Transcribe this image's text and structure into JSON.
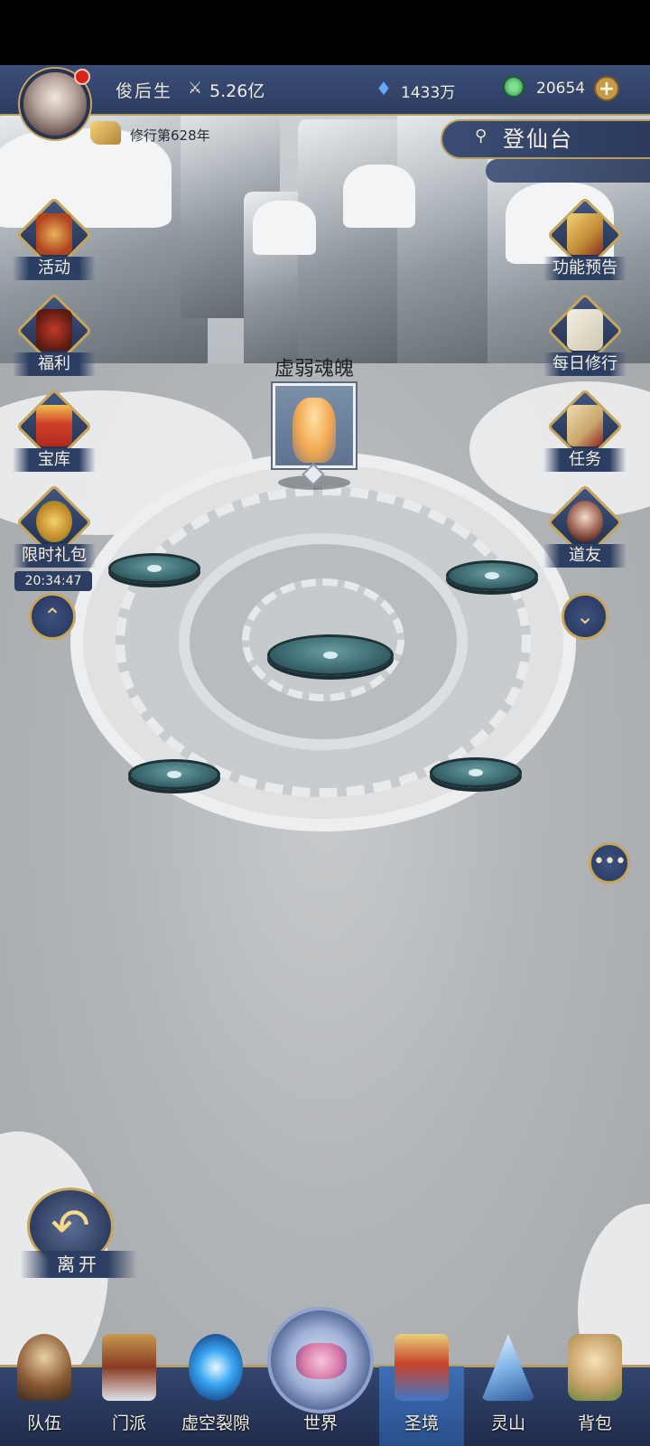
{
  "player": {
    "name": "俊后生",
    "power": "5.26亿",
    "cultivation_year": "修行第628年"
  },
  "currency": {
    "spirit_stones": "1433万",
    "jade": "20654"
  },
  "location": "登仙台",
  "left_menu": [
    {
      "label": "活动",
      "icon": "lantern-icon"
    },
    {
      "label": "福利",
      "icon": "armor-icon"
    },
    {
      "label": "宝库",
      "icon": "treasure-chest-icon"
    },
    {
      "label": "限时礼包",
      "icon": "money-bag-icon"
    }
  ],
  "gift_timer": "20:34:47",
  "right_menu": [
    {
      "label": "功能预告",
      "icon": "scroll-icon"
    },
    {
      "label": "每日修行",
      "icon": "book-icon"
    },
    {
      "label": "任务",
      "icon": "quest-scroll-icon"
    },
    {
      "label": "道友",
      "icon": "companion-portrait-icon"
    }
  ],
  "enemy": {
    "name": "虚弱魂魄"
  },
  "leave_label": "离开",
  "bottom_nav": [
    {
      "label": "队伍",
      "icon": "team-icon"
    },
    {
      "label": "门派",
      "icon": "sect-pavilion-icon"
    },
    {
      "label": "虚空裂隙",
      "icon": "void-rift-icon"
    },
    {
      "label": "世界",
      "icon": "world-orb-icon"
    },
    {
      "label": "圣境",
      "icon": "holy-realm-icon"
    },
    {
      "label": "灵山",
      "icon": "spirit-mountain-icon"
    },
    {
      "label": "背包",
      "icon": "backpack-icon"
    }
  ],
  "colors": {
    "panel": "#2d3e63",
    "gold_trim": "#c6a55c",
    "disc": "#3d6b72",
    "active_tab": "#3d6fb5"
  }
}
